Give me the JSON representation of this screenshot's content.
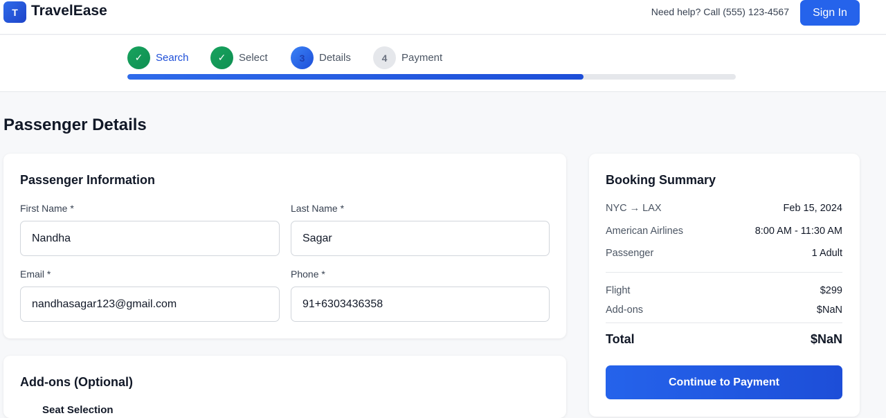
{
  "header": {
    "logo_letter": "T",
    "brand": "TravelEase",
    "help": "Need help? Call (555) 123-4567",
    "signin_label": "Sign In"
  },
  "steps": [
    {
      "marker": "✓",
      "label": "Search",
      "state": "done"
    },
    {
      "marker": "✓",
      "label": "Select",
      "state": "done"
    },
    {
      "marker": "3",
      "label": "Details",
      "state": "current"
    },
    {
      "marker": "4",
      "label": "Payment",
      "state": "todo"
    }
  ],
  "progress": 0.75,
  "page_title": "Passenger Details",
  "passenger_form": {
    "title": "Passenger Information",
    "first_name": {
      "label": "First Name *",
      "value": "Nandha"
    },
    "last_name": {
      "label": "Last Name *",
      "value": "Sagar"
    },
    "email": {
      "label": "Email *",
      "value": "nandhasagar123@gmail.com"
    },
    "phone": {
      "label": "Phone *",
      "value": "91+6303436358"
    }
  },
  "addons": {
    "title": "Add-ons (Optional)",
    "first_item": "Seat Selection"
  },
  "summary": {
    "title": "Booking Summary",
    "route": "NYC → LAX",
    "date": "Feb 15, 2024",
    "airline": "American Airlines",
    "time": "8:00 AM - 11:30 AM",
    "passenger_label": "Passenger",
    "passenger_value": "1 Adult",
    "flight_label": "Flight",
    "flight_value": "$299",
    "addons_label": "Add-ons",
    "addons_value": "$NaN",
    "total_label": "Total",
    "total_value": "$NaN",
    "continue_label": "Continue to Payment"
  },
  "colors": {
    "accent": "#2563eb",
    "done": "#16a34a"
  }
}
